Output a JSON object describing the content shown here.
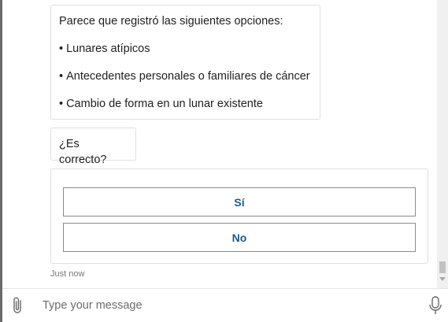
{
  "messages": {
    "options_intro": "Parece que registró las siguientes opciones:",
    "options": [
      "Lunares atípicos",
      "Antecedentes personales o familiares de cáncer",
      "Cambio de forma en un lunar existente"
    ],
    "bullet": "•",
    "question": "¿Es correcto?"
  },
  "card": {
    "yes_label": "Sí",
    "no_label": "No"
  },
  "timestamp": "Just now",
  "input": {
    "placeholder": "Type your message"
  },
  "icons": {
    "attach": "paperclip-icon",
    "mic": "microphone-icon"
  },
  "colors": {
    "button_text": "#1a5a96",
    "button_border": "#8a8a8a",
    "bubble_border": "#e0e0e0"
  }
}
